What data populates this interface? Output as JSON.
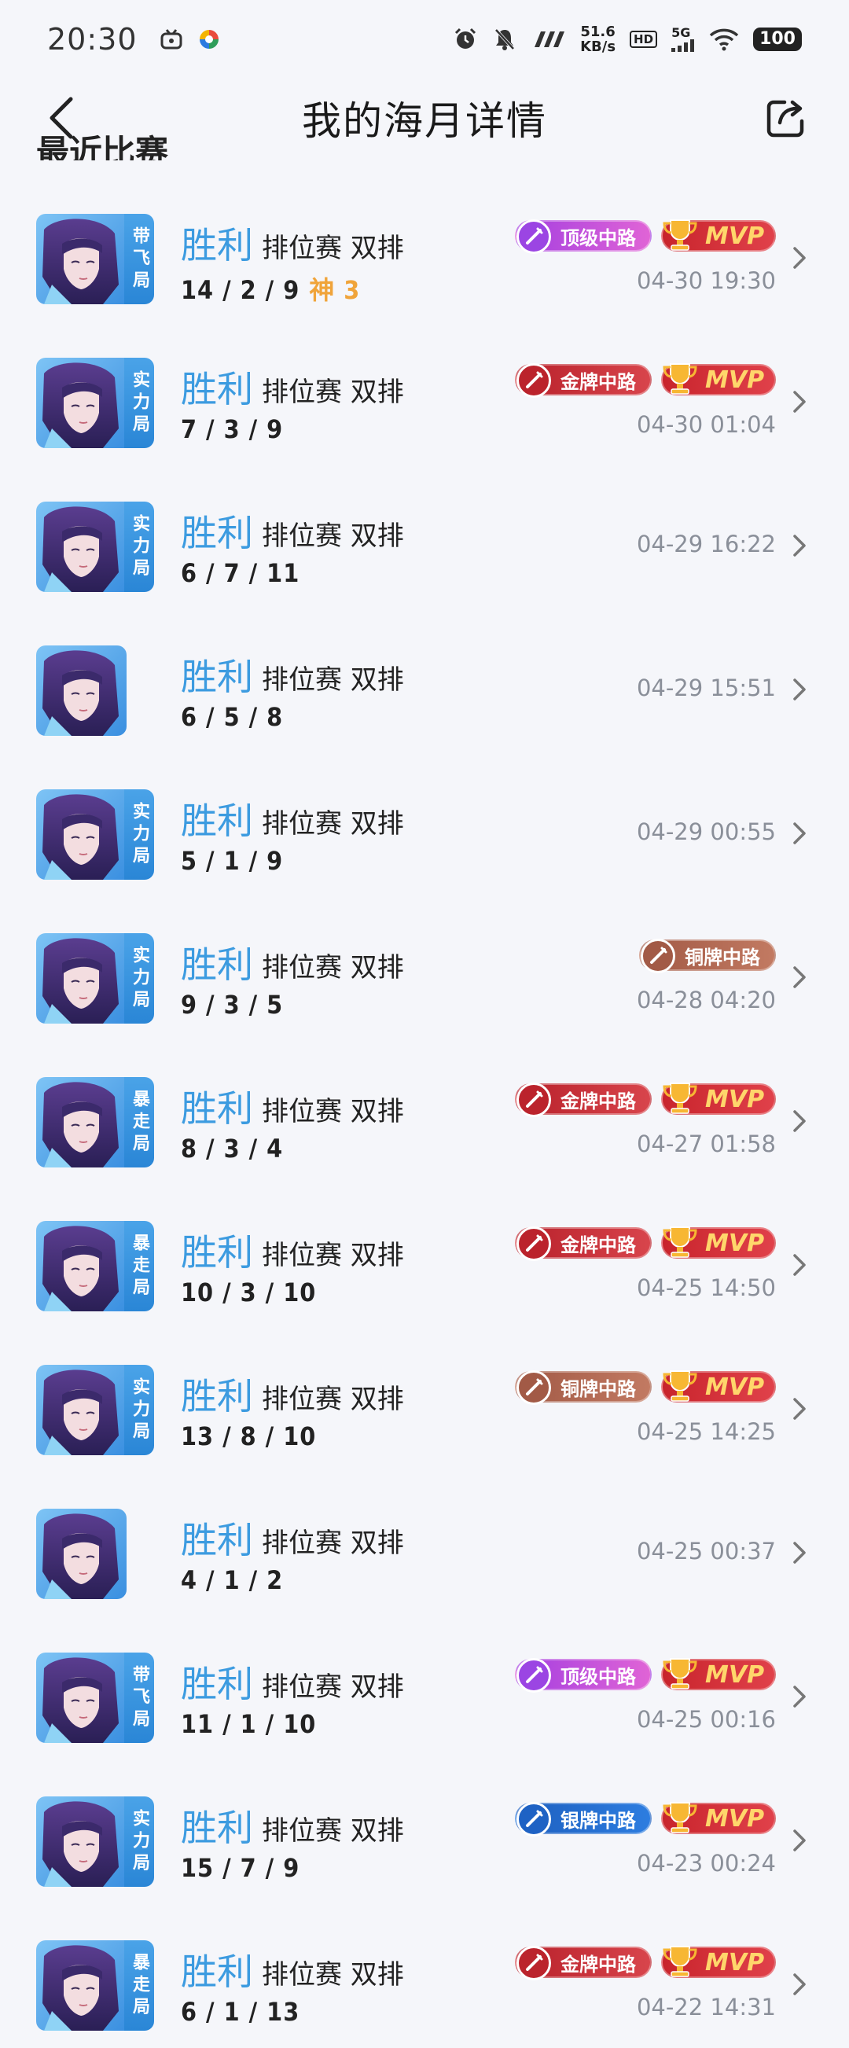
{
  "status_bar": {
    "time": "20:30",
    "net_speed_value": "51.6",
    "net_speed_unit": "KB/s",
    "hd": "HD",
    "network": "5G",
    "battery": "100"
  },
  "header": {
    "title": "我的海月详情"
  },
  "section": {
    "label": "最近比赛"
  },
  "colors": {
    "result_blue": "#3c9be0",
    "god_orange": "#f0a43a",
    "top_lane": "#a43fe0",
    "gold_lane": "#b8202a",
    "bronze_lane": "#a15945",
    "silver_lane": "#1d5fbf",
    "mvp_red": "#c8242c"
  },
  "matches": [
    {
      "tag": "带飞局",
      "result": "胜利",
      "mode": "排位赛 双排",
      "kda": "14 / 2 / 9",
      "god": "神 3",
      "badge": "顶级中路",
      "badge_type": "top",
      "mvp": "MVP",
      "time": "04-30 19:30"
    },
    {
      "tag": "实力局",
      "result": "胜利",
      "mode": "排位赛 双排",
      "kda": "7 / 3 / 9",
      "god": "",
      "badge": "金牌中路",
      "badge_type": "gold",
      "mvp": "MVP",
      "time": "04-30 01:04"
    },
    {
      "tag": "实力局",
      "result": "胜利",
      "mode": "排位赛 双排",
      "kda": "6 / 7 / 11",
      "god": "",
      "badge": "",
      "badge_type": "",
      "mvp": "",
      "time": "04-29 16:22"
    },
    {
      "tag": "",
      "result": "胜利",
      "mode": "排位赛 双排",
      "kda": "6 / 5 / 8",
      "god": "",
      "badge": "",
      "badge_type": "",
      "mvp": "",
      "time": "04-29 15:51"
    },
    {
      "tag": "实力局",
      "result": "胜利",
      "mode": "排位赛 双排",
      "kda": "5 / 1 / 9",
      "god": "",
      "badge": "",
      "badge_type": "",
      "mvp": "",
      "time": "04-29 00:55"
    },
    {
      "tag": "实力局",
      "result": "胜利",
      "mode": "排位赛 双排",
      "kda": "9 / 3 / 5",
      "god": "",
      "badge": "铜牌中路",
      "badge_type": "bronze",
      "mvp": "",
      "time": "04-28 04:20"
    },
    {
      "tag": "暴走局",
      "result": "胜利",
      "mode": "排位赛 双排",
      "kda": "8 / 3 / 4",
      "god": "",
      "badge": "金牌中路",
      "badge_type": "gold",
      "mvp": "MVP",
      "time": "04-27 01:58"
    },
    {
      "tag": "暴走局",
      "result": "胜利",
      "mode": "排位赛 双排",
      "kda": "10 / 3 / 10",
      "god": "",
      "badge": "金牌中路",
      "badge_type": "gold",
      "mvp": "MVP",
      "time": "04-25 14:50"
    },
    {
      "tag": "实力局",
      "result": "胜利",
      "mode": "排位赛 双排",
      "kda": "13 / 8 / 10",
      "god": "",
      "badge": "铜牌中路",
      "badge_type": "bronze",
      "mvp": "MVP",
      "time": "04-25 14:25"
    },
    {
      "tag": "",
      "result": "胜利",
      "mode": "排位赛 双排",
      "kda": "4 / 1 / 2",
      "god": "",
      "badge": "",
      "badge_type": "",
      "mvp": "",
      "time": "04-25 00:37"
    },
    {
      "tag": "带飞局",
      "result": "胜利",
      "mode": "排位赛 双排",
      "kda": "11 / 1 / 10",
      "god": "",
      "badge": "顶级中路",
      "badge_type": "top",
      "mvp": "MVP",
      "time": "04-25 00:16"
    },
    {
      "tag": "实力局",
      "result": "胜利",
      "mode": "排位赛 双排",
      "kda": "15 / 7 / 9",
      "god": "",
      "badge": "银牌中路",
      "badge_type": "silver",
      "mvp": "MVP",
      "time": "04-23 00:24"
    },
    {
      "tag": "暴走局",
      "result": "胜利",
      "mode": "排位赛 双排",
      "kda": "6 / 1 / 13",
      "god": "",
      "badge": "金牌中路",
      "badge_type": "gold",
      "mvp": "MVP",
      "time": "04-22 14:31"
    }
  ]
}
